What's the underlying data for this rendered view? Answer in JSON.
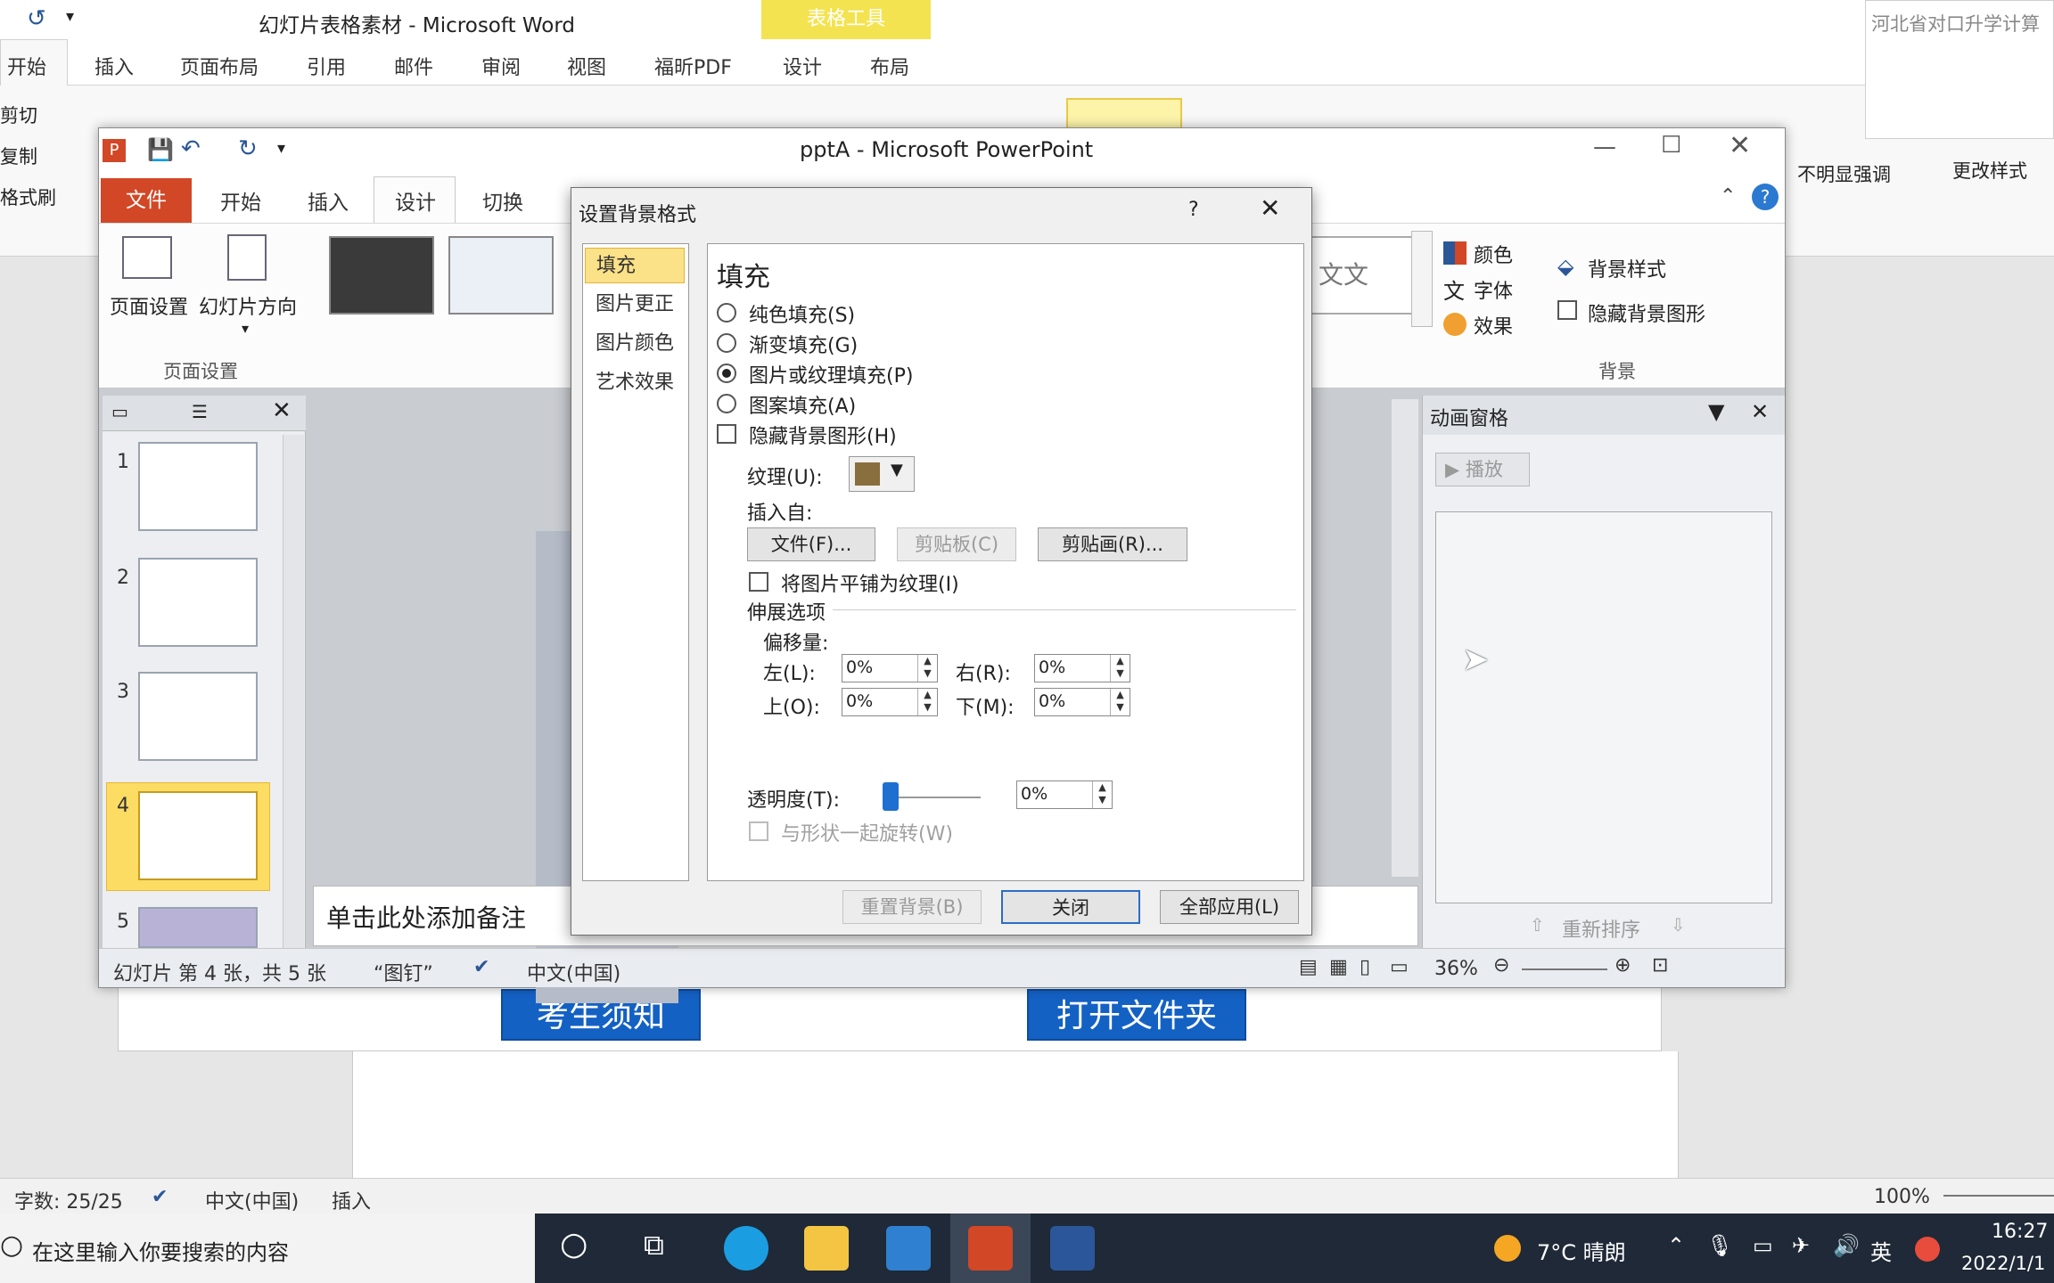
{
  "word": {
    "title": "幻灯片表格素材 - Microsoft Word",
    "table_tools": "表格工具",
    "tabs": [
      "开始",
      "插入",
      "页面布局",
      "引用",
      "邮件",
      "审阅",
      "视图",
      "福昕PDF",
      "设计",
      "布局"
    ],
    "clipboard": [
      "剪切",
      "复制",
      "格式刷"
    ],
    "styles_right": [
      "不明显强调",
      "更改样式"
    ],
    "corner_text": "河北省对口升学计算",
    "buttons": [
      "考生须知",
      "打开文件夹"
    ],
    "status": {
      "words": "字数: 25/25",
      "lang": "中文(中国)",
      "mode": "插入",
      "zoom": "100%"
    }
  },
  "taskbar": {
    "search_placeholder": "在这里输入你要搜索的内容",
    "weather": "7°C 晴朗",
    "ime": "英",
    "time": "16:27",
    "date": "2022/1/1"
  },
  "ppt": {
    "title": "pptA - Microsoft PowerPoint",
    "file_tab": "文件",
    "tabs": [
      "开始",
      "插入",
      "设计",
      "切换"
    ],
    "ribbon": {
      "page_setup": "页面设置",
      "orientation": "幻灯片方向",
      "group_page": "页面设置",
      "theme_text": "文文",
      "colors": "颜色",
      "fonts": "字体",
      "effects": "效果",
      "bg_styles": "背景样式",
      "hide_bg": "隐藏背景图形",
      "group_bg": "背景"
    },
    "slides": [
      "1",
      "2",
      "3",
      "4",
      "5"
    ],
    "notes_placeholder": "单击此处添加备注",
    "anim": {
      "title": "动画窗格",
      "play": "播放",
      "reorder": "重新排序"
    },
    "status": {
      "slide": "幻灯片 第 4 张，共 5 张",
      "theme": "“图钉”",
      "lang": "中文(中国)",
      "zoom": "36%"
    }
  },
  "dialog": {
    "title": "设置背景格式",
    "help": "?",
    "nav": [
      "填充",
      "图片更正",
      "图片颜色",
      "艺术效果"
    ],
    "heading": "填充",
    "options": [
      "纯色填充(S)",
      "渐变填充(G)",
      "图片或纹理填充(P)",
      "图案填充(A)"
    ],
    "hide_bg": "隐藏背景图形(H)",
    "texture_label": "纹理(U):",
    "insert_from": "插入自:",
    "file_btn": "文件(F)...",
    "clipboard_btn": "剪贴板(C)",
    "clipart_btn": "剪贴画(R)...",
    "tile": "将图片平铺为纹理(I)",
    "stretch": "伸展选项",
    "offset": "偏移量:",
    "left": "左(L):",
    "right": "右(R):",
    "top": "上(O):",
    "bottom": "下(M):",
    "left_val": "0%",
    "right_val": "0%",
    "top_val": "0%",
    "bottom_val": "0%",
    "transparency": "透明度(T):",
    "transparency_val": "0%",
    "rotate": "与形状一起旋转(W)",
    "reset_btn": "重置背景(B)",
    "close_btn": "关闭",
    "apply_all_btn": "全部应用(L)"
  }
}
